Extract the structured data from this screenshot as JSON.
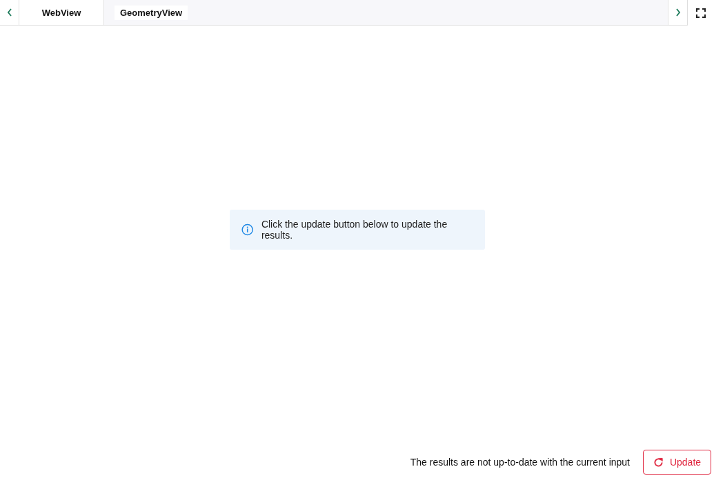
{
  "tabs": [
    {
      "label": "WebView",
      "selected": true
    },
    {
      "label": "GeometryView",
      "selected": false
    }
  ],
  "info_message": "Click the update button below to update the results.",
  "footer": {
    "status_text": "The results are not up-to-date with the current input",
    "update_button": "Update"
  }
}
